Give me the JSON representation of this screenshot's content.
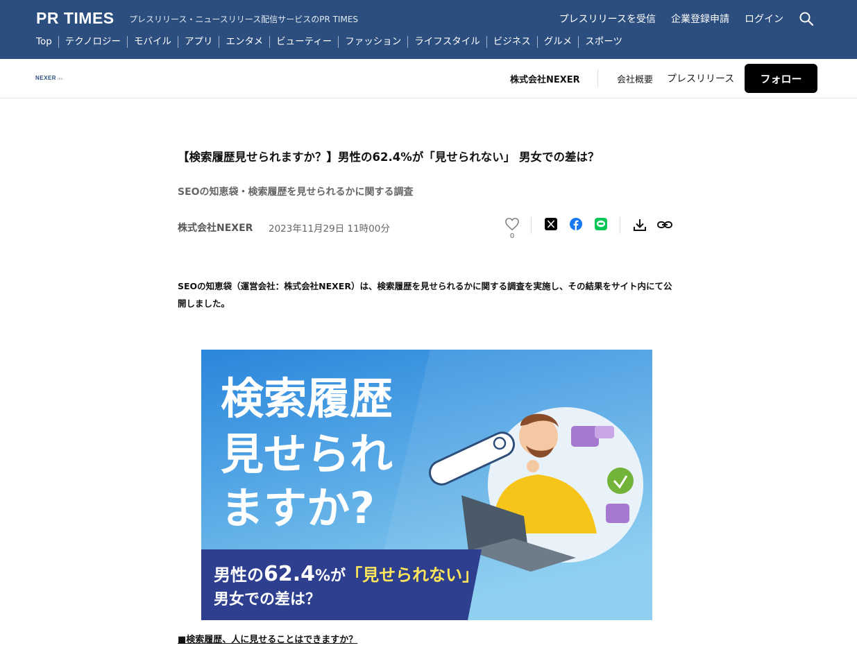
{
  "header": {
    "logo": "PR TIMES",
    "tagline": "プレスリリース・ニュースリリース配信サービスのPR TIMES",
    "links": [
      "プレスリリースを受信",
      "企業登録申請",
      "ログイン"
    ],
    "search_icon": "search-icon",
    "categories": [
      "Top",
      "テクノロジー",
      "モバイル",
      "アプリ",
      "エンタメ",
      "ビューティー",
      "ファッション",
      "ライフスタイル",
      "ビジネス",
      "グルメ",
      "スポーツ"
    ]
  },
  "company_bar": {
    "logo": "NEXER",
    "logo_suffix": "inc.",
    "name": "株式会社NEXER",
    "links": [
      "会社概要",
      "プレスリリース"
    ],
    "follow_label": "フォロー"
  },
  "article": {
    "title": "【検索履歴見せられますか？】男性の62.4%が「見せられない」 男女での差は？",
    "subtitle": "SEOの知恵袋・検索履歴を見せられるかに関する調査",
    "company": "株式会社NEXER",
    "date": "2023年11月29日 11時00分",
    "like_count": "0",
    "lead": " SEOの知恵袋（運営会社：株式会社NEXER）は、検索履歴を見せられるかに関する調査を実施し、その結果をサイト内にて公開しました。",
    "section_heading": "■検索履歴、人に見せることはできますか？"
  },
  "hero": {
    "headline_lines": [
      "検索履歴",
      "見せられ",
      "ますか?"
    ],
    "banner_prefix": "男性の",
    "banner_number": "62.4",
    "banner_unit": "%が",
    "banner_quote": "「見せられない」",
    "banner_line2": "男女での差は？",
    "colors": {
      "bg_top": "#2f8fe0",
      "bg_bottom": "#7cc6f0",
      "banner": "#2e3f8f",
      "highlight": "#ffe65a"
    }
  },
  "share_icons": [
    "x-icon",
    "facebook-icon",
    "line-icon",
    "download-icon",
    "link-icon"
  ],
  "colors": {
    "header_bg": "#2b4e7f",
    "follow_bg": "#000000"
  }
}
